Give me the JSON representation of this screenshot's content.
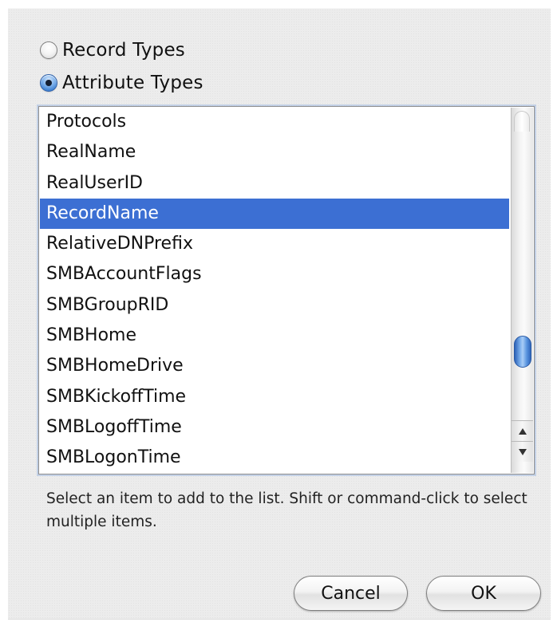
{
  "dialog": {
    "radio_options": [
      {
        "label": "Record Types",
        "checked": false
      },
      {
        "label": "Attribute Types",
        "checked": true
      }
    ],
    "list_items": [
      "Protocols",
      "RealName",
      "RealUserID",
      "RecordName",
      "RelativeDNPrefix",
      "SMBAccountFlags",
      "SMBGroupRID",
      "SMBHome",
      "SMBHomeDrive",
      "SMBKickoffTime",
      "SMBLogoffTime",
      "SMBLogonTime"
    ],
    "selected_item": "RecordName",
    "hint_text": "Select an item to add to the list. Shift or command-click to select multiple items.",
    "cancel_label": "Cancel",
    "ok_label": "OK"
  },
  "colors": {
    "selection": "#3c6fd3",
    "radio_checked": "#3d7fd1",
    "dialog_background": "#ececec"
  },
  "icons": {
    "scroll_up": "triangle-up-icon",
    "scroll_down": "triangle-down-icon"
  }
}
